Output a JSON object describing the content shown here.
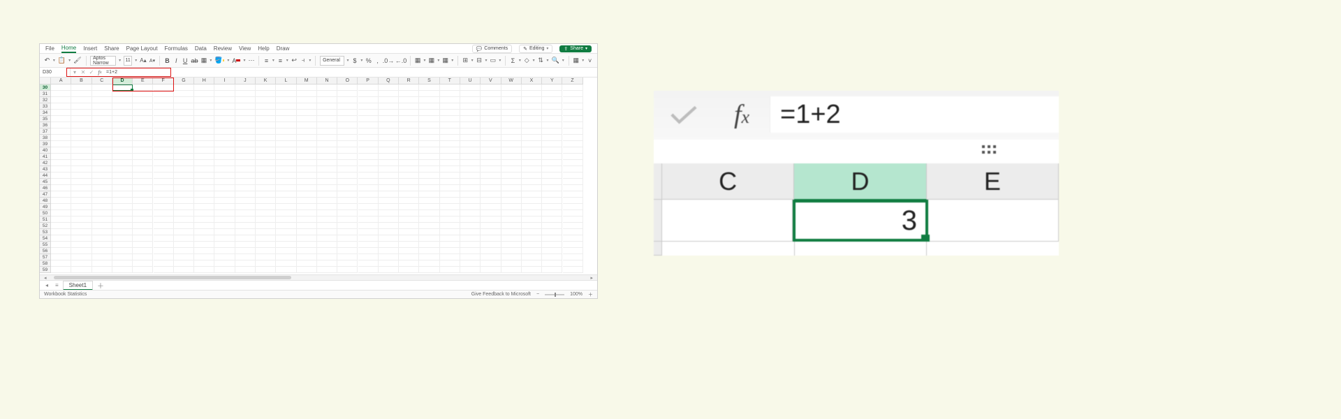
{
  "menu": {
    "items": [
      "File",
      "Home",
      "Insert",
      "Share",
      "Page Layout",
      "Formulas",
      "Data",
      "Review",
      "View",
      "Help",
      "Draw"
    ],
    "active_index": 1,
    "comments": "Comments",
    "editing": "Editing",
    "share": "Share"
  },
  "ribbon": {
    "font_name": "Aptos Narrow",
    "font_size": "11",
    "number_format": "General"
  },
  "formula_bar": {
    "name_box": "D30",
    "formula": "=1+2"
  },
  "grid": {
    "columns": [
      "A",
      "B",
      "C",
      "D",
      "E",
      "F",
      "G",
      "H",
      "I",
      "J",
      "K",
      "L",
      "M",
      "N",
      "O",
      "P",
      "Q",
      "R",
      "S",
      "T",
      "U",
      "V",
      "W",
      "X",
      "Y",
      "Z"
    ],
    "first_row": 30,
    "last_row": 59,
    "selected_cell": "D30",
    "selected_col_index": 3,
    "selected_row": 30
  },
  "sheetbar": {
    "sheet_name": "Sheet1"
  },
  "statusbar": {
    "wb_stats": "Workbook Statistics",
    "feedback": "Give Feedback to Microsoft",
    "zoom": "100%"
  },
  "inset": {
    "formula": "=1+2",
    "columns": [
      "C",
      "D",
      "E"
    ],
    "selected_col_index": 1,
    "cell_value": "3"
  },
  "colors": {
    "accent": "#107c41",
    "fill_hint": "#ffd24a",
    "font_color_hint": "#c00"
  }
}
